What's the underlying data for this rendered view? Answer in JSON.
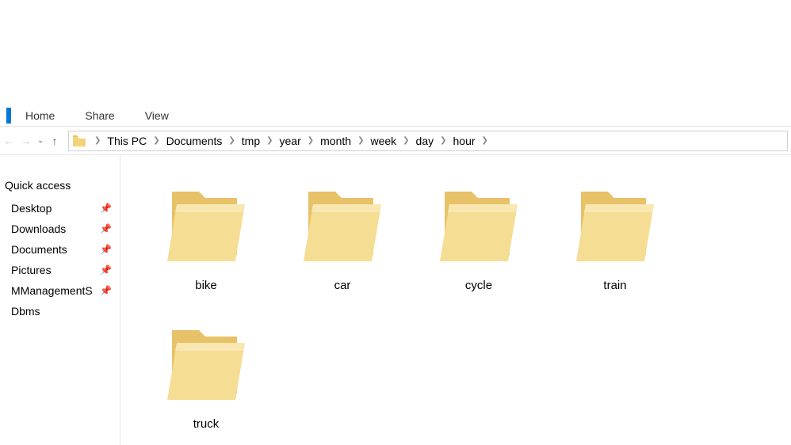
{
  "ribbon": {
    "tabs": [
      "Home",
      "Share",
      "View"
    ]
  },
  "breadcrumb": [
    "This PC",
    "Documents",
    "tmp",
    "year",
    "month",
    "week",
    "day",
    "hour"
  ],
  "sidebar": {
    "heading": "Quick access",
    "items": [
      {
        "label": "Desktop",
        "pinned": true
      },
      {
        "label": "Downloads",
        "pinned": true
      },
      {
        "label": "Documents",
        "pinned": true
      },
      {
        "label": "Pictures",
        "pinned": true
      },
      {
        "label": "MManagementS",
        "pinned": true
      },
      {
        "label": "Dbms",
        "pinned": false
      }
    ]
  },
  "folders": [
    "bike",
    "car",
    "cycle",
    "train",
    "truck"
  ]
}
